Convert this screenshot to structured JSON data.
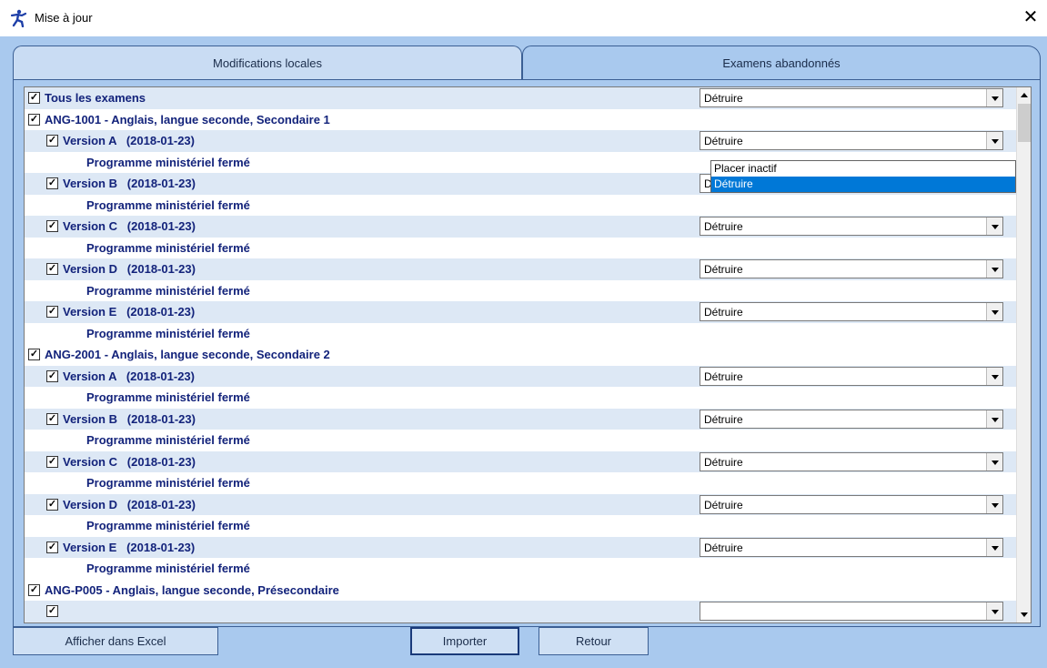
{
  "window": {
    "title": "Mise à jour",
    "close_glyph": "✕"
  },
  "tabs": [
    {
      "label": "Modifications locales"
    },
    {
      "label": "Examens abandonnés"
    }
  ],
  "list": {
    "rows": [
      {
        "kind": "group",
        "label": "Tous les examens",
        "checked": true,
        "action": "Détruire",
        "shade": true
      },
      {
        "kind": "group",
        "label": "ANG-1001 - Anglais, langue seconde, Secondaire 1",
        "checked": true,
        "shade": false
      },
      {
        "kind": "version",
        "label": "Version A   (2018-01-23)",
        "checked": true,
        "action": "Détruire",
        "shade": true
      },
      {
        "kind": "note",
        "label": "Programme ministériel fermé",
        "shade": false
      },
      {
        "kind": "version",
        "label": "Version B   (2018-01-23)",
        "checked": true,
        "action": "Détruire",
        "shade": true
      },
      {
        "kind": "note",
        "label": "Programme ministériel fermé",
        "shade": false
      },
      {
        "kind": "version",
        "label": "Version C   (2018-01-23)",
        "checked": true,
        "action": "Détruire",
        "shade": true
      },
      {
        "kind": "note",
        "label": "Programme ministériel fermé",
        "shade": false
      },
      {
        "kind": "version",
        "label": "Version D   (2018-01-23)",
        "checked": true,
        "action": "Détruire",
        "shade": true
      },
      {
        "kind": "note",
        "label": "Programme ministériel fermé",
        "shade": false
      },
      {
        "kind": "version",
        "label": "Version E   (2018-01-23)",
        "checked": true,
        "action": "Détruire",
        "shade": true
      },
      {
        "kind": "note",
        "label": "Programme ministériel fermé",
        "shade": false
      },
      {
        "kind": "group",
        "label": "ANG-2001 - Anglais, langue seconde, Secondaire 2",
        "checked": true,
        "shade": false
      },
      {
        "kind": "version",
        "label": "Version A   (2018-01-23)",
        "checked": true,
        "action": "Détruire",
        "shade": true
      },
      {
        "kind": "note",
        "label": "Programme ministériel fermé",
        "shade": false
      },
      {
        "kind": "version",
        "label": "Version B   (2018-01-23)",
        "checked": true,
        "action": "Détruire",
        "shade": true
      },
      {
        "kind": "note",
        "label": "Programme ministériel fermé",
        "shade": false
      },
      {
        "kind": "version",
        "label": "Version C   (2018-01-23)",
        "checked": true,
        "action": "Détruire",
        "shade": true
      },
      {
        "kind": "note",
        "label": "Programme ministériel fermé",
        "shade": false
      },
      {
        "kind": "version",
        "label": "Version D   (2018-01-23)",
        "checked": true,
        "action": "Détruire",
        "shade": true
      },
      {
        "kind": "note",
        "label": "Programme ministériel fermé",
        "shade": false
      },
      {
        "kind": "version",
        "label": "Version E   (2018-01-23)",
        "checked": true,
        "action": "Détruire",
        "shade": true
      },
      {
        "kind": "note",
        "label": "Programme ministériel fermé",
        "shade": false
      },
      {
        "kind": "group",
        "label": "ANG-P005 - Anglais, langue seconde, Présecondaire",
        "checked": true,
        "shade": false
      },
      {
        "kind": "version",
        "label": "",
        "checked": true,
        "action": "",
        "shade": true
      }
    ],
    "dropdown_options": [
      "Placer inactif",
      "Détruire"
    ],
    "dropdown_selected": "Détruire"
  },
  "buttons": {
    "excel": "Afficher dans Excel",
    "import": "Importer",
    "back": "Retour"
  },
  "colors": {
    "client_bg": "#a9c9ee",
    "row_shade": "#dde8f5",
    "text_blue": "#13237b",
    "selection": "#0078d7"
  }
}
